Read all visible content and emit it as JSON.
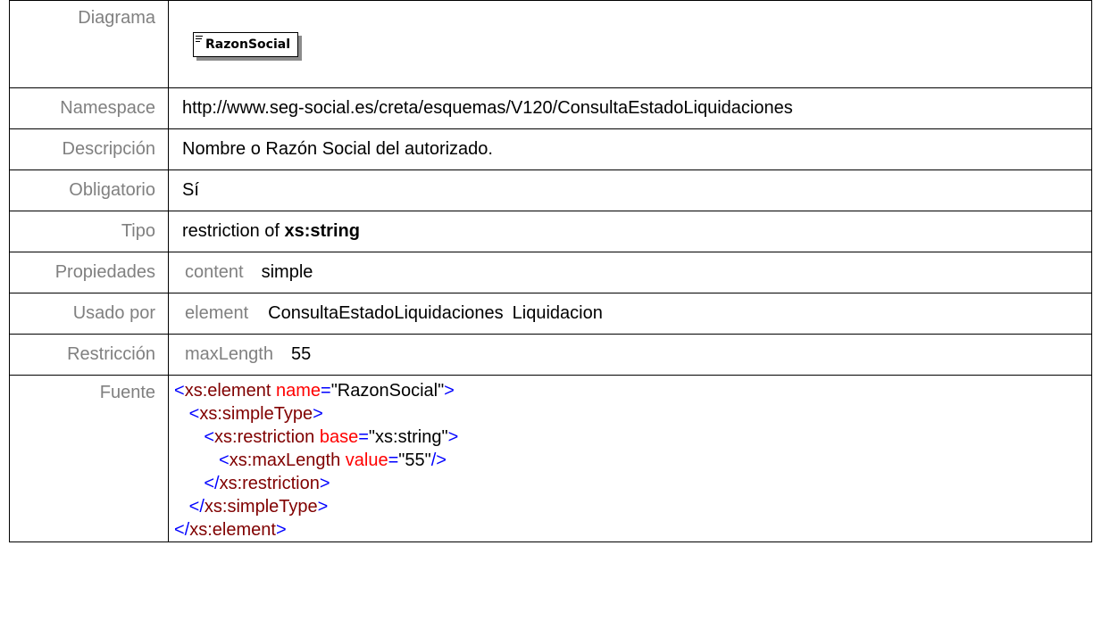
{
  "rows": {
    "diagram": {
      "label": "Diagrama",
      "node_name": "RazonSocial",
      "node_icon": "element-lines-icon"
    },
    "namespace": {
      "label": "Namespace",
      "value": "http://www.seg-social.es/creta/esquemas/V120/ConsultaEstadoLiquidaciones"
    },
    "description": {
      "label": "Descripción",
      "value": "Nombre o Razón Social del autorizado."
    },
    "required": {
      "label": "Obligatorio",
      "value": "Sí"
    },
    "type": {
      "label": "Tipo",
      "prefix": "restriction of ",
      "base": "xs:string"
    },
    "properties": {
      "label": "Propiedades",
      "key": "content",
      "value": "simple"
    },
    "used_by": {
      "label": "Usado por",
      "key": "element",
      "values": [
        "ConsultaEstadoLiquidaciones",
        "Liquidacion"
      ]
    },
    "restriction": {
      "label": "Restricción",
      "key": "maxLength",
      "value": "55"
    },
    "source": {
      "label": "Fuente",
      "lines": [
        {
          "indent": "",
          "open": "<",
          "tag": "xs:element",
          "attr": "name",
          "eq": "=",
          "val": "\"RazonSocial\"",
          "close": ">"
        },
        {
          "indent": "   ",
          "open": "<",
          "tag": "xs:simpleType",
          "close": ">"
        },
        {
          "indent": "      ",
          "open": "<",
          "tag": "xs:restriction",
          "attr": "base",
          "eq": "=",
          "val": "\"xs:string\"",
          "close": ">"
        },
        {
          "indent": "         ",
          "open": "<",
          "tag": "xs:maxLength",
          "attr": "value",
          "eq": "=",
          "val": "\"55\"",
          "close": "/>"
        },
        {
          "indent": "      ",
          "open": "</",
          "tag": "xs:restriction",
          "close": ">"
        },
        {
          "indent": "   ",
          "open": "</",
          "tag": "xs:simpleType",
          "close": ">"
        },
        {
          "indent": "",
          "open": "</",
          "tag": "xs:element",
          "close": ">"
        }
      ]
    }
  },
  "colors": {
    "label": "#808080",
    "tag": "#800000",
    "bracket": "#0000ff",
    "attribute": "#ff0000"
  }
}
